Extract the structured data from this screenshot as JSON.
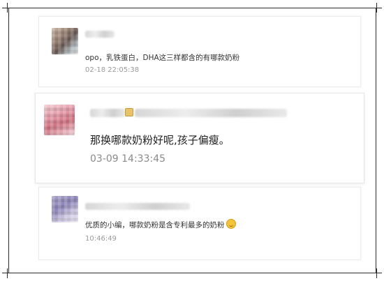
{
  "comments": [
    {
      "message": "opo，乳铁蛋白，DHA这三样都含的有哪款奶粉",
      "timestamp": "02-18 22:05:38"
    },
    {
      "message": "那换哪款奶粉好呢,孩子偏瘦。",
      "timestamp": "03-09 14:33:45"
    },
    {
      "message": "优质的小编，哪款奶粉是含专利最多的奶粉",
      "emoji": "grinning-emoji-icon",
      "timestamp": "10:46:49"
    }
  ]
}
